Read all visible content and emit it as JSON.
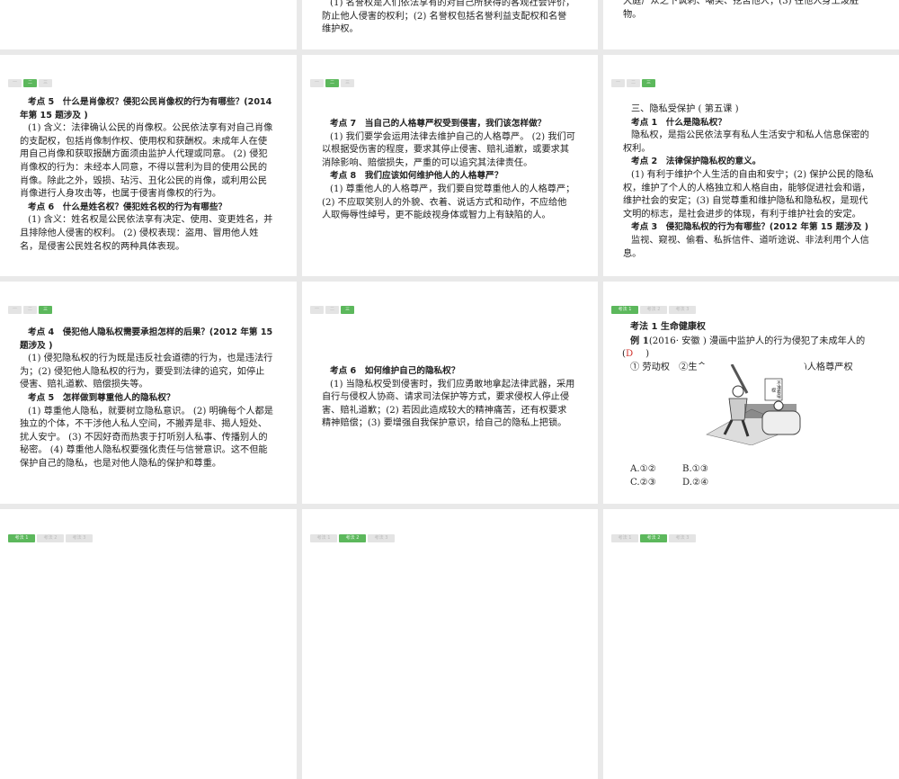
{
  "slides": [
    {
      "id": "r1c1",
      "tabs": [],
      "active": -1,
      "paras": []
    },
    {
      "id": "r1c2",
      "tabs": [],
      "active": -1,
      "paras": [
        {
          "t": "p",
          "text": "(1) 名誉权是人们依法享有的对自己所获得的客观社会评价，防止他人侵害的权利；(2) 名誉权包括名誉利益支配权和名誉维护权。"
        }
      ]
    },
    {
      "id": "r1c3",
      "tabs": [],
      "active": -1,
      "paras": [
        {
          "t": "p",
          "text": "大庭广众之下讽刺、嘲笑、挖苦他人；(3) 往他人身上泼脏物。"
        }
      ]
    },
    {
      "id": "r2c1",
      "tabs": [
        "一",
        "二",
        "三"
      ],
      "active": 1,
      "paras": [
        {
          "t": "h",
          "text": "考点 5　什么是肖像权？侵犯公民肖像权的行为有哪些？(2014 年第 15 题涉及 )"
        },
        {
          "t": "p",
          "text": "(1) 含义：法律确认公民的肖像权。公民依法享有对自己肖像的支配权，包括肖像制作权、使用权和获酬权。未成年人在使用自己肖像和获取报酬方面须由监护人代理或同意。 (2) 侵犯肖像权的行为：未经本人同意，不得以营利为目的使用公民的肖像。除此之外，毁损、玷污、丑化公民的肖像，或利用公民肖像进行人身攻击等，也属于侵害肖像权的行为。"
        },
        {
          "t": "h",
          "text": "考点 6　什么是姓名权？侵犯姓名权的行为有哪些？"
        },
        {
          "t": "p",
          "text": "(1) 含义：姓名权是公民依法享有决定、使用、变更姓名，并且排除他人侵害的权利。 (2) 侵权表现：盗用、冒用他人姓名，是侵害公民姓名权的两种具体表现。"
        }
      ]
    },
    {
      "id": "r2c2",
      "tabs": [
        "一",
        "二",
        "三"
      ],
      "active": 1,
      "paras": [
        {
          "t": "h",
          "text": "考点 7　当自己的人格尊严权受到侵害，我们该怎样做？"
        },
        {
          "t": "p",
          "text": "(1) 我们要学会运用法律去维护自己的人格尊严。 (2) 我们可以根据受伤害的程度，要求其停止侵害、赔礼道歉，或要求其消除影响、赔偿损失，严重的可以追究其法律责任。"
        },
        {
          "t": "h",
          "text": "考点 8　我们应该如何维护他人的人格尊严？"
        },
        {
          "t": "p",
          "text": "(1) 尊重他人的人格尊严，我们要自觉尊重他人的人格尊严；(2) 不应取笑别人的外貌、衣着、说话方式和动作，不应给他人取侮辱性绰号，更不能歧视身体或智力上有缺陷的人。"
        }
      ]
    },
    {
      "id": "r2c3",
      "tabs": [
        "一",
        "二",
        "三"
      ],
      "active": 2,
      "paras": [
        {
          "t": "p",
          "text": "三、隐私受保护 ( 第五课 )"
        },
        {
          "t": "h",
          "text": "考点 1　什么是隐私权？"
        },
        {
          "t": "p",
          "text": "隐私权，是指公民依法享有私人生活安宁和私人信息保密的权利。"
        },
        {
          "t": "h",
          "text": "考点 2　法律保护隐私权的意义。"
        },
        {
          "t": "p",
          "text": "(1) 有利于维护个人生活的自由和安宁；(2) 保护公民的隐私权，维护了个人的人格独立和人格自由，能够促进社会和谐，维护社会的安定；(3) 自觉尊重和维护隐私和隐私权，是现代文明的标志，是社会进步的体现，有利于维护社会的安定。"
        },
        {
          "t": "h",
          "text": "考点 3　侵犯隐私权的行为有哪些？(2012 年第 15 题涉及 )"
        },
        {
          "t": "p",
          "text": "监视、窥视、偷看、私拆信件、道听途说、非法利用个人信息。"
        }
      ]
    },
    {
      "id": "r3c1",
      "tabs": [
        "一",
        "二",
        "三"
      ],
      "active": 2,
      "paras": [
        {
          "t": "h",
          "text": "考点 4　侵犯他人隐私权需要承担怎样的后果？(2012 年第 15 题涉及 )"
        },
        {
          "t": "p",
          "text": "(1) 侵犯隐私权的行为既是违反社会道德的行为，也是违法行为；(2) 侵犯他人隐私权的行为，要受到法律的追究，如停止侵害、赔礼道歉、赔偿损失等。"
        },
        {
          "t": "h",
          "text": "考点 5　怎样做到尊重他人的隐私权？"
        },
        {
          "t": "p",
          "text": "(1) 尊重他人隐私，就要树立隐私意识。 (2) 明确每个人都是独立的个体，不干涉他人私人空间，不搬弄是非、揭人短处、扰人安宁。 (3) 不因好奇而热衷于打听别人私事、传播别人的秘密。 (4) 尊重他人隐私权要强化责任与信誉意识。这不但能保护自己的隐私，也是对他人隐私的保护和尊重。"
        }
      ]
    },
    {
      "id": "r3c2",
      "tabs": [
        "一",
        "二",
        "三"
      ],
      "active": 2,
      "paras": [
        {
          "t": "h",
          "text": "考点 6　如何维护自己的隐私权？"
        },
        {
          "t": "p",
          "text": "(1) 当隐私权受到侵害时，我们应勇敢地拿起法律武器，采用自行与侵权人协商、请求司法保护等方式，要求侵权人停止侵害、赔礼道歉；(2) 若因此造成较大的精神痛苦，还有权要求精神赔偿；(3) 要增强自我保护意识，给自己的隐私上把锁。"
        }
      ]
    },
    {
      "id": "r3c3",
      "tabs": [
        "考法 1",
        "考法 2",
        "考法 3"
      ],
      "active": 0,
      "paras": []
    },
    {
      "id": "r4c1",
      "tabs": [
        "考法 1",
        "考法 2",
        "考法 3"
      ],
      "active": 0,
      "paras": []
    },
    {
      "id": "r4c2",
      "tabs": [
        "考法 1",
        "考法 2",
        "考法 3"
      ],
      "active": 1,
      "paras": []
    },
    {
      "id": "r4c3",
      "tabs": [
        "考法 1",
        "考法 2",
        "考法 3"
      ],
      "active": 1,
      "paras": []
    }
  ],
  "example": {
    "heading_prefix": "考法 1 ",
    "heading": "生命健康权",
    "question_prefix": "例 1",
    "question": "(2016· 安徽 ) 漫画中监护人的行为侵犯了未成年人的",
    "answer_open": "(",
    "answer": "D",
    "answer_close": ")",
    "option_left": "① 劳动权　②生命",
    "option_right": ")人格尊严权",
    "choices": [
      "A.①②",
      "B.①③",
      "C.②③",
      "D.②④"
    ],
    "comic_sign": "不准看电视"
  },
  "colors": {
    "accent": "#5cb85c",
    "answer": "#d0302a",
    "background": "#e9e9e9"
  }
}
